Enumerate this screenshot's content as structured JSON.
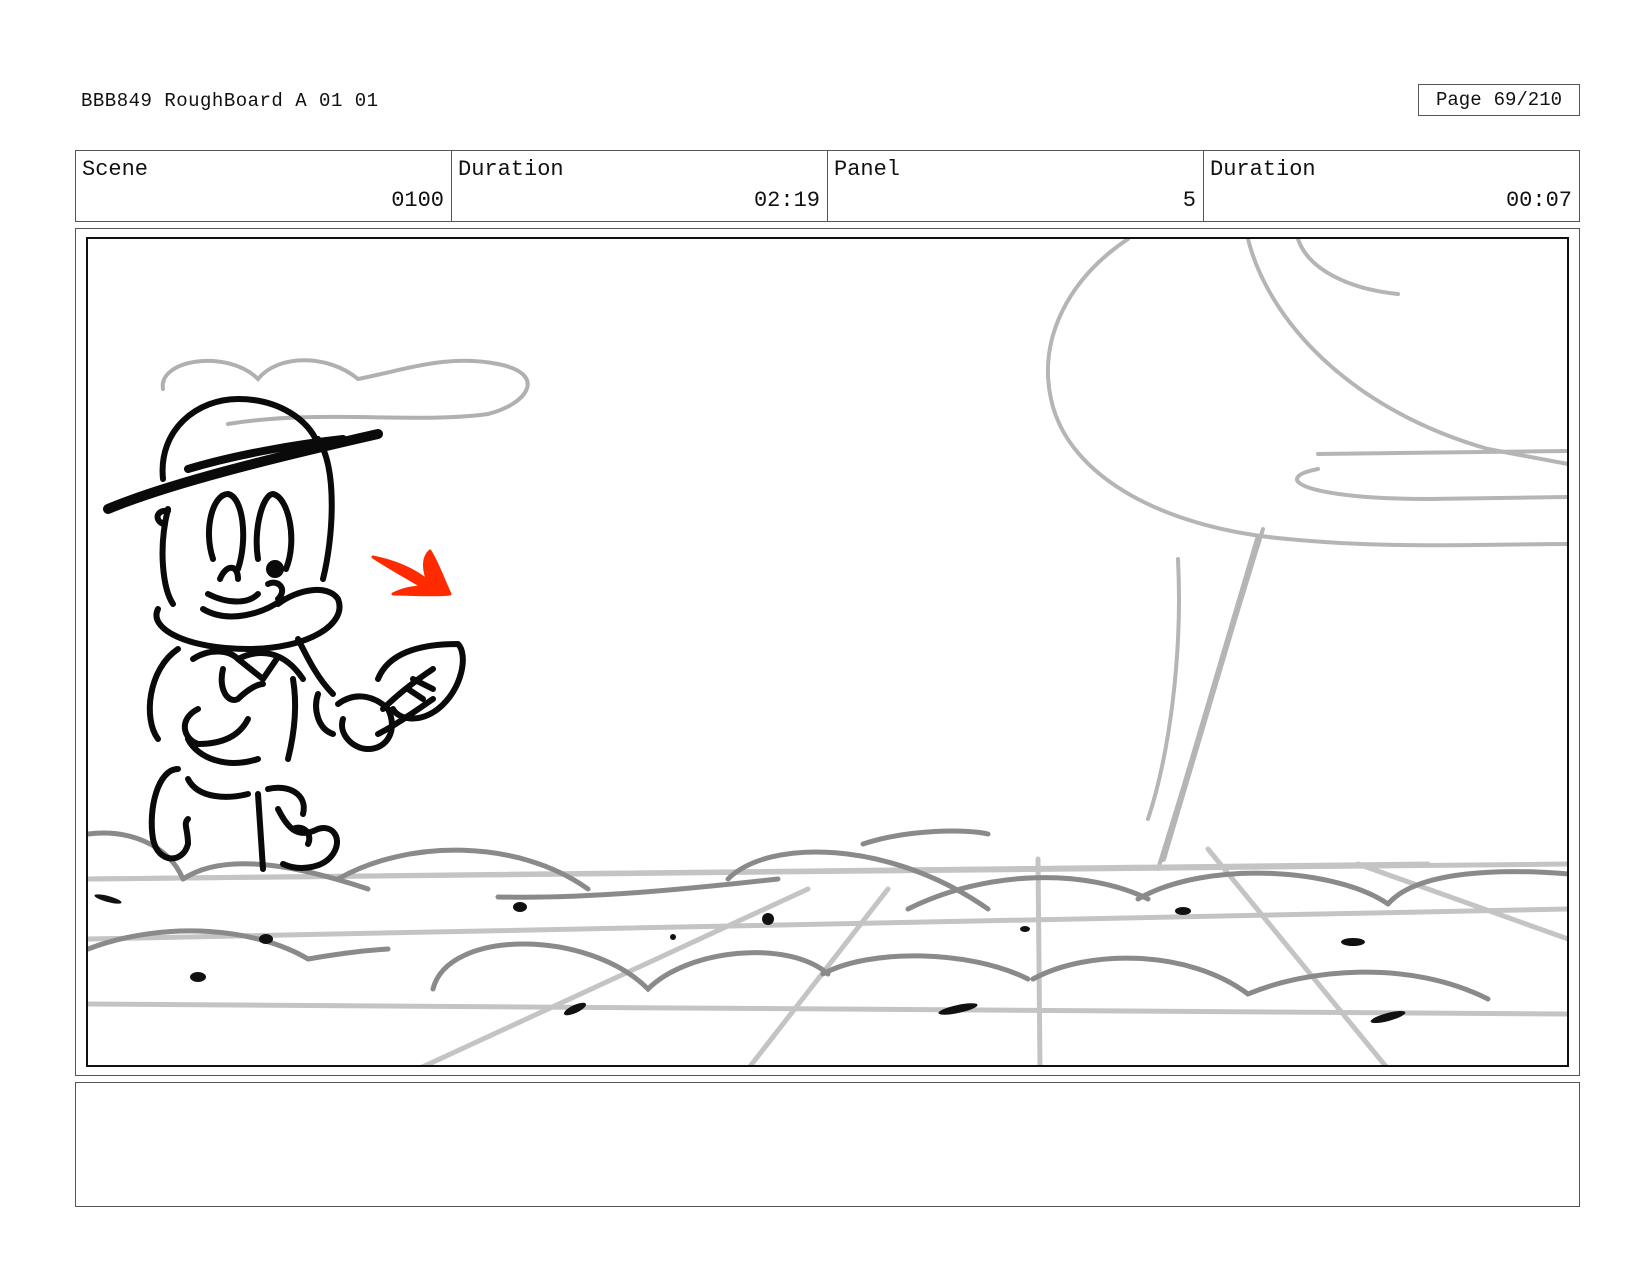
{
  "header": {
    "title": "BBB849 RoughBoard A 01 01",
    "page_label": "Page",
    "page_value": "69/210"
  },
  "info": {
    "scene_label": "Scene",
    "scene_value": "0100",
    "scene_duration_label": "Duration",
    "scene_duration_value": "02:19",
    "panel_label": "Panel",
    "panel_value": "5",
    "panel_duration_label": "Duration",
    "panel_duration_value": "00:07"
  },
  "panel": {
    "description": "rough sketch",
    "accent_color": "#ff2a00"
  },
  "notes": {
    "text": ""
  }
}
